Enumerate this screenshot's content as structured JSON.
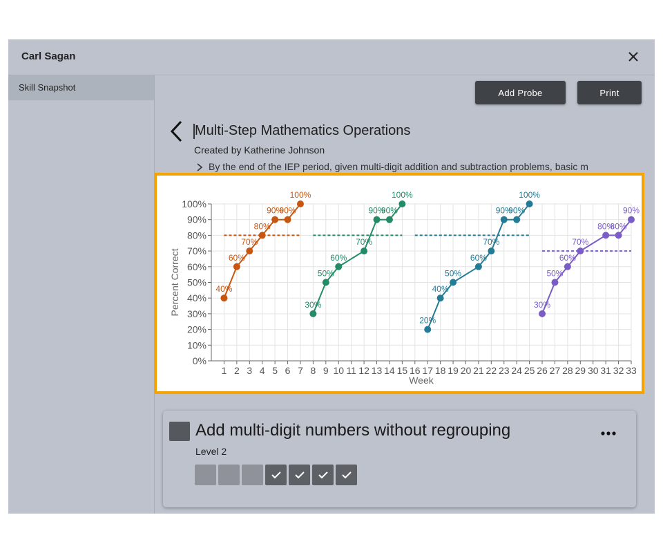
{
  "window": {
    "student_name": "Carl Sagan"
  },
  "sidebar": {
    "items": [
      {
        "label": "Skill Snapshot"
      }
    ]
  },
  "toolbar": {
    "add_probe_label": "Add Probe",
    "print_label": "Print"
  },
  "skill": {
    "title": "Multi-Step Mathematics Operations",
    "created_by": "Created by Katherine Johnson",
    "goal_text": "By the end of the IEP period, given multi-digit addition and subtraction problems, basic m"
  },
  "chart_data": {
    "type": "line",
    "xlabel": "Week",
    "ylabel": "Percent Correct",
    "xlim": [
      0,
      33
    ],
    "ylim": [
      0,
      100
    ],
    "x_ticks": [
      "1",
      "2",
      "3",
      "4",
      "5",
      "6",
      "7",
      "8",
      "9",
      "10",
      "11",
      "12",
      "13",
      "14",
      "15",
      "16",
      "17",
      "18",
      "19",
      "20",
      "21",
      "22",
      "23",
      "24",
      "25",
      "26",
      "27",
      "28",
      "29",
      "30",
      "31",
      "32",
      "33"
    ],
    "y_ticks": [
      "0%",
      "10%",
      "20%",
      "30%",
      "40%",
      "50%",
      "60%",
      "70%",
      "80%",
      "90%",
      "100%"
    ],
    "grid": true,
    "series": [
      {
        "color": "#c8560f",
        "points": [
          [
            1,
            40
          ],
          [
            2,
            60
          ],
          [
            3,
            70
          ],
          [
            4,
            80
          ],
          [
            5,
            90
          ],
          [
            6,
            90
          ],
          [
            7,
            100
          ]
        ],
        "labels": [
          "40%",
          "60%",
          "70%",
          "80%",
          "90%",
          "90%",
          "100%"
        ],
        "goal": {
          "x": [
            1,
            7
          ],
          "y": 80
        }
      },
      {
        "color": "#238b66",
        "points": [
          [
            8,
            30
          ],
          [
            9,
            50
          ],
          [
            10,
            60
          ],
          [
            12,
            70
          ],
          [
            13,
            90
          ],
          [
            14,
            90
          ],
          [
            15,
            100
          ]
        ],
        "labels": [
          "30%",
          "50%",
          "60%",
          "70%",
          "90%",
          "90%",
          "100%"
        ],
        "goal": {
          "x": [
            8,
            15
          ],
          "y": 80
        }
      },
      {
        "color": "#237b95",
        "points": [
          [
            17,
            20
          ],
          [
            18,
            40
          ],
          [
            19,
            50
          ],
          [
            21,
            60
          ],
          [
            22,
            70
          ],
          [
            23,
            90
          ],
          [
            24,
            90
          ],
          [
            25,
            100
          ]
        ],
        "labels": [
          "20%",
          "40%",
          "50%",
          "60%",
          "70%",
          "90%",
          "90%",
          "100%"
        ],
        "goal": {
          "x": [
            16,
            25
          ],
          "y": 80
        }
      },
      {
        "color": "#7a5cc7",
        "points": [
          [
            26,
            30
          ],
          [
            27,
            50
          ],
          [
            28,
            60
          ],
          [
            29,
            70
          ],
          [
            31,
            80
          ],
          [
            32,
            80
          ],
          [
            33,
            90
          ]
        ],
        "labels": [
          "30%",
          "50%",
          "60%",
          "70%",
          "80%",
          "80%",
          "90%"
        ],
        "goal": {
          "x": [
            26,
            33
          ],
          "y": 70
        }
      }
    ]
  },
  "card": {
    "title": "Add multi-digit numbers without regrouping",
    "level": "Level 2",
    "probes": [
      "empty",
      "empty",
      "empty",
      "done",
      "done",
      "done",
      "done"
    ]
  },
  "colors": {
    "highlight": "#f5a300",
    "button": "#3f4246",
    "panel": "#bdc2cc"
  },
  "icons": {
    "close": "close-icon",
    "back": "chevron-left-icon",
    "expand": "chevron-right-icon",
    "more": "more-horizontal-icon",
    "check": "check-icon"
  }
}
